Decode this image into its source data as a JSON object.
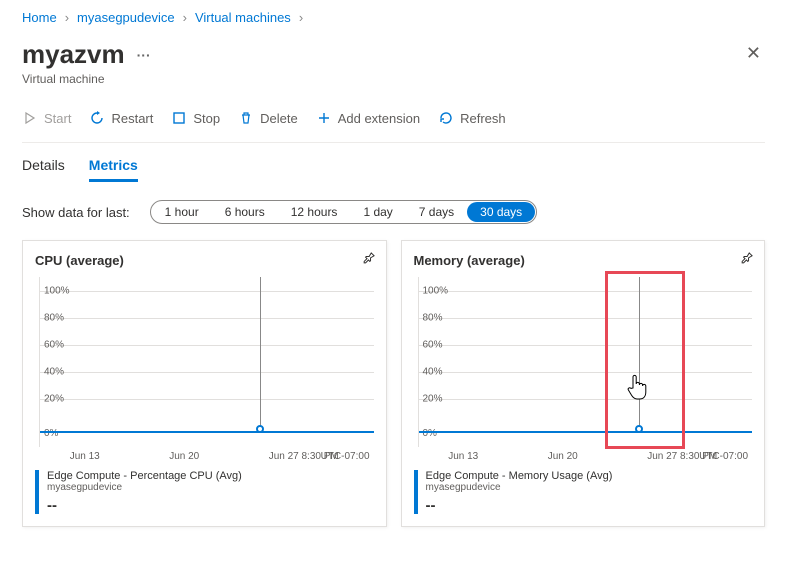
{
  "breadcrumb": [
    "Home",
    "myasegpudevice",
    "Virtual machines"
  ],
  "header": {
    "title": "myazvm",
    "subtitle": "Virtual machine"
  },
  "toolbar": {
    "start_label": "Start",
    "restart_label": "Restart",
    "stop_label": "Stop",
    "delete_label": "Delete",
    "add_ext_label": "Add extension",
    "refresh_label": "Refresh"
  },
  "tabs": {
    "details": "Details",
    "metrics": "Metrics",
    "active": "metrics"
  },
  "range": {
    "label": "Show data for last:",
    "options": [
      "1 hour",
      "6 hours",
      "12 hours",
      "1 day",
      "7 days",
      "30 days"
    ],
    "active": "30 days"
  },
  "chart_data": [
    {
      "type": "line",
      "title": "CPU (average)",
      "ylabel": "",
      "ylim": [
        0,
        100
      ],
      "y_ticks": [
        "0%",
        "20%",
        "40%",
        "60%",
        "80%",
        "100%"
      ],
      "x_ticks": [
        "Jun 13",
        "Jun 20",
        "Jun 27 8:30 PM"
      ],
      "tz": "UTC-07:00",
      "legend": {
        "series": "Edge Compute - Percentage CPU (Avg)",
        "sub": "myasegpudevice",
        "value": "--"
      },
      "series": [
        {
          "name": "CPU",
          "values_near_zero": true
        }
      ]
    },
    {
      "type": "line",
      "title": "Memory (average)",
      "ylabel": "",
      "ylim": [
        0,
        100
      ],
      "y_ticks": [
        "0%",
        "20%",
        "40%",
        "60%",
        "80%",
        "100%"
      ],
      "x_ticks": [
        "Jun 13",
        "Jun 20",
        "Jun 27 8:30 PM"
      ],
      "tz": "UTC-07:00",
      "legend": {
        "series": "Edge Compute - Memory Usage (Avg)",
        "sub": "myasegpudevice",
        "value": "--"
      },
      "series": [
        {
          "name": "Memory",
          "values_near_zero": true
        }
      ]
    }
  ]
}
